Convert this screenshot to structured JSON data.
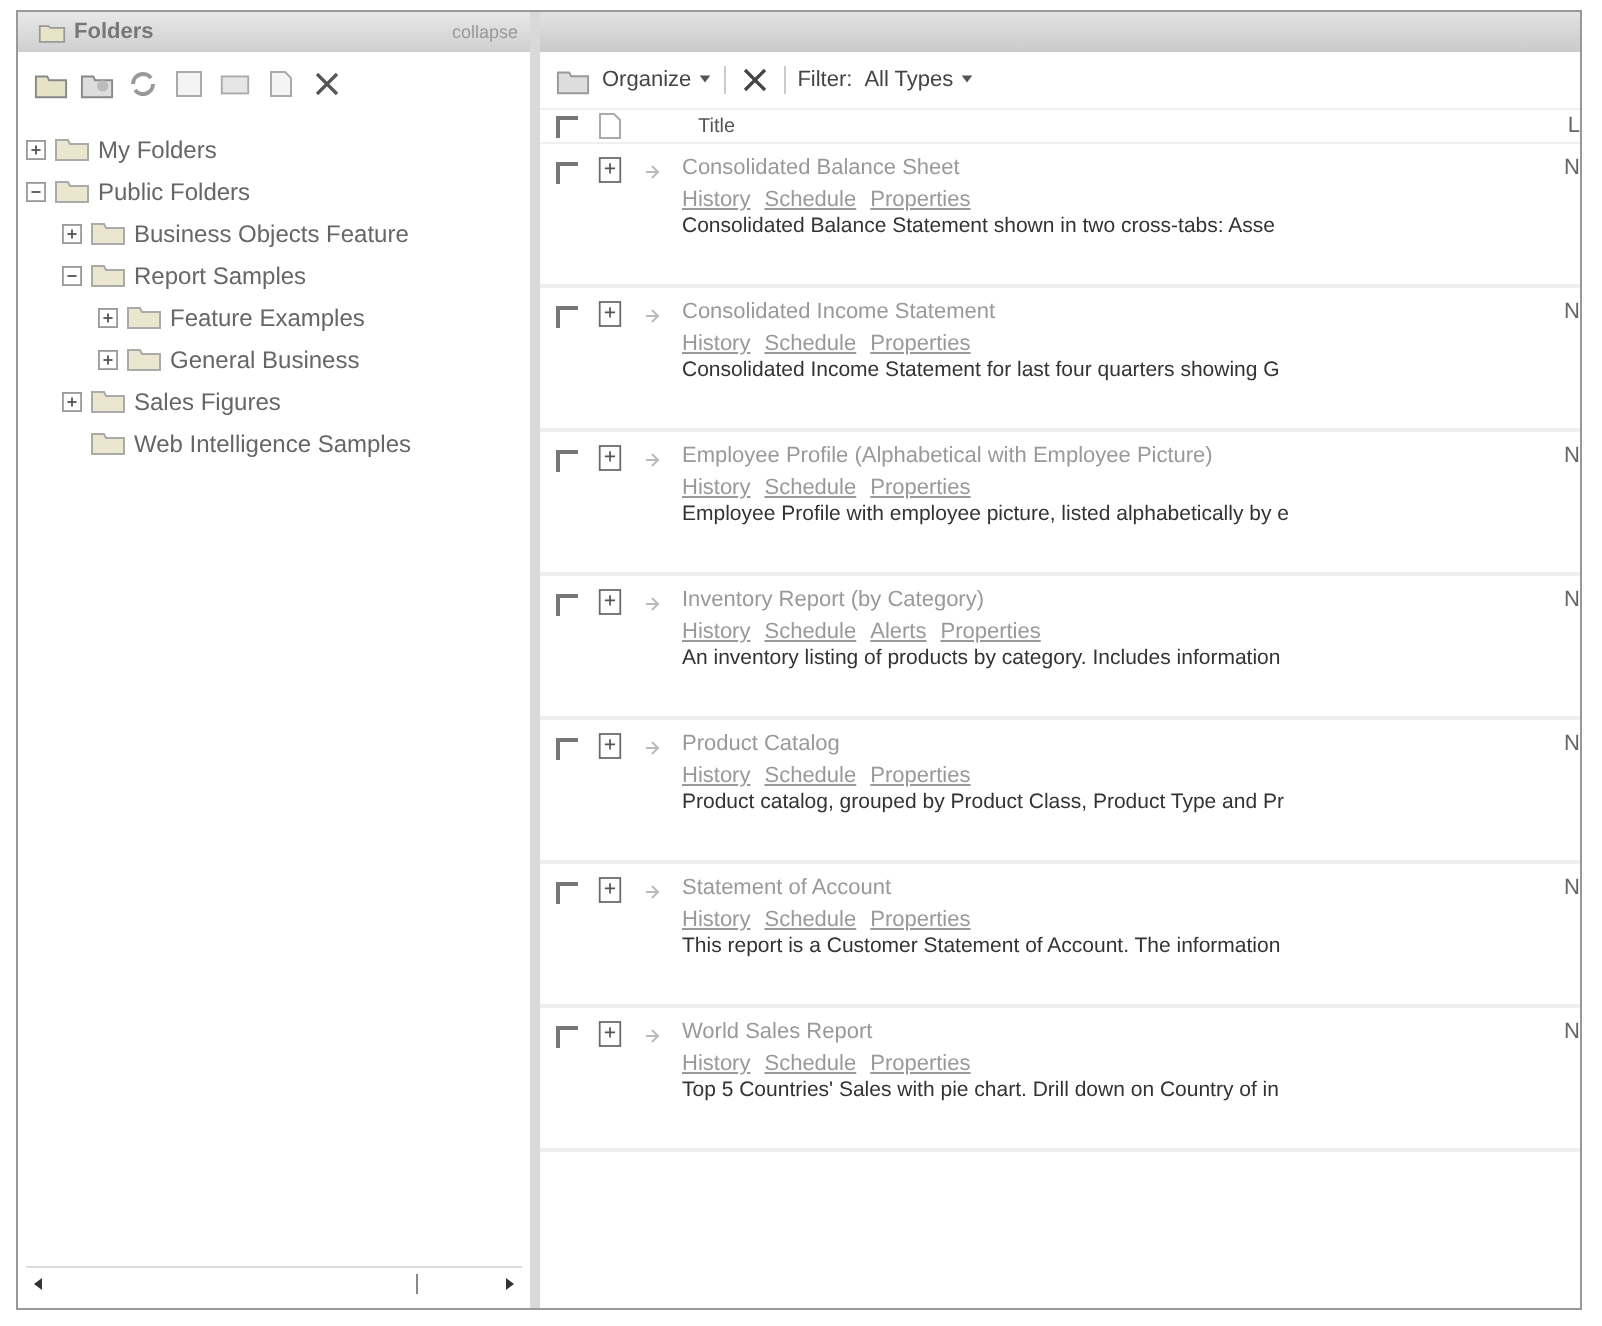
{
  "folders_panel": {
    "title": "Folders",
    "collapse_label": "collapse",
    "tree": [
      {
        "label": "My Folders",
        "expanded": false
      },
      {
        "label": "Public Folders",
        "expanded": true,
        "children": [
          {
            "label": "Business Objects Feature",
            "expanded": false
          },
          {
            "label": "Report Samples",
            "expanded": true,
            "children": [
              {
                "label": "Feature Examples",
                "expanded": false
              },
              {
                "label": "General Business",
                "expanded": false
              }
            ]
          },
          {
            "label": "Sales Figures",
            "expanded": false
          },
          {
            "label": "Web Intelligence Samples"
          }
        ]
      }
    ]
  },
  "toolbar": {
    "organize": "Organize",
    "filter_label": "Filter:",
    "filter_value": "All Types"
  },
  "table": {
    "header_checked": false,
    "columns": [
      "Title",
      "L"
    ],
    "rows": [
      {
        "title": "Consolidated Balance Sheet",
        "links": [
          "History",
          "Schedule",
          "Properties"
        ],
        "description": "Consolidated Balance Statement shown in two cross-tabs: Asse",
        "column_2": "N",
        "checked": false
      },
      {
        "title": "Consolidated Income Statement",
        "links": [
          "History",
          "Schedule",
          "Properties"
        ],
        "description": "Consolidated Income Statement for last four quarters showing G",
        "column_2": "N",
        "checked": false
      },
      {
        "title": "Employee Profile (Alphabetical with Employee Picture)",
        "links": [
          "History",
          "Schedule",
          "Properties"
        ],
        "description": "Employee Profile with employee picture, listed alphabetically by e",
        "column_2": "N",
        "checked": false
      },
      {
        "title": "Inventory Report (by Category)",
        "links": [
          "History",
          "Schedule",
          "Alerts",
          "Properties"
        ],
        "description": "An inventory listing of products by category. Includes information",
        "column_2": "N",
        "checked": false
      },
      {
        "title": "Product Catalog",
        "links": [
          "History",
          "Schedule",
          "Properties"
        ],
        "description": "Product catalog, grouped by Product Class, Product Type and Pr",
        "column_2": "N",
        "checked": false
      },
      {
        "title": "Statement of Account",
        "links": [
          "History",
          "Schedule",
          "Properties"
        ],
        "description": "This report is a Customer Statement of Account. The information",
        "column_2": "N",
        "checked": false
      },
      {
        "title": "World Sales Report",
        "links": [
          "History",
          "Schedule",
          "Properties"
        ],
        "description": "Top 5 Countries' Sales with pie chart. Drill down on Country of in",
        "column_2": "N",
        "checked": false
      }
    ]
  }
}
